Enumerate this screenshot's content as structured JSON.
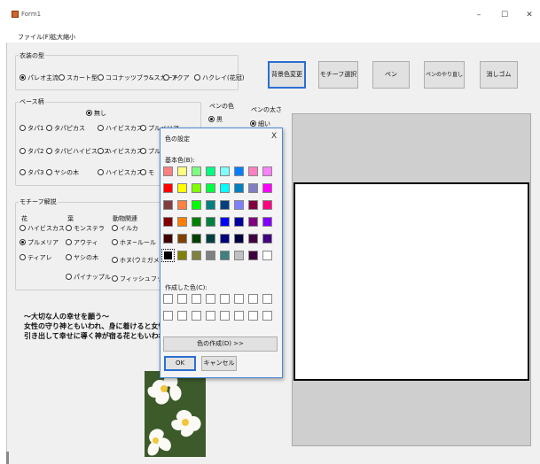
{
  "window": {
    "title": "Form1",
    "minimize_glyph": "–",
    "maximize_glyph": "☐",
    "close_glyph": "✕"
  },
  "menu": [
    "ファイル(F)",
    "拡大縮小"
  ],
  "dress_type": {
    "label": "衣装の型",
    "options": [
      "パレオ主流",
      "スカート型",
      "ココナッツブラ&スカート",
      "アクア",
      "ハクレイ(花冠)"
    ],
    "selected": 0
  },
  "base": {
    "label": "ベース柄",
    "none": "無し",
    "rows": [
      [
        "タパ1",
        "タパピカス",
        "ハイビスカス1",
        "プルメリア"
      ],
      [
        "タパ2",
        "タパビハイビスカス",
        "ハイビスカス2",
        "プル"
      ],
      [
        "タパ3",
        "ヤシの木",
        "ハイビスカス3",
        "モ"
      ]
    ]
  },
  "pen_color": {
    "label": "ペンの色",
    "option": "黒"
  },
  "pen_size": {
    "label": "ペンの太さ",
    "option": "細い"
  },
  "motif": {
    "label": "モチーフ解説",
    "headers": [
      "花",
      "葉",
      "動物関連"
    ],
    "col1": [
      "ハイビスカス",
      "プルメリア",
      "ティアレ"
    ],
    "col2": [
      "モンステラ",
      "アウティ",
      "ヤシの木",
      "パイナップル"
    ],
    "col3": [
      "イルカ",
      "ホヌ~ルール",
      "ホヌ(ウミガメ)",
      "フィッシュフック"
    ]
  },
  "description": {
    "line1": "～大切な人の幸せを願う～",
    "line2": "女性の守り神ともいわれ、身に着けると女性",
    "line3": "引き出して幸せに導く神が宿る花ともいわれ"
  },
  "toolbar": {
    "bg_color": "背景色変更",
    "motif_select": "モチーフ選択",
    "pen": "ペン",
    "pen_undo": "ペンのやり直し",
    "eraser": "消しゴム"
  },
  "color_dialog": {
    "title": "色の設定",
    "close": "X",
    "basic_label": "基本色(B):",
    "custom_label": "作成した色(C):",
    "define_button": "色の作成(D) >>",
    "ok": "OK",
    "cancel": "キャンセル",
    "basic_colors": [
      [
        "#ff8080",
        "#ffff80",
        "#80ff80",
        "#00ff80",
        "#80ffff",
        "#0080ff",
        "#ff80c0",
        "#ff80ff"
      ],
      [
        "#ff0000",
        "#ffff00",
        "#80ff00",
        "#00ff40",
        "#00ffff",
        "#0080c0",
        "#8080c0",
        "#ff00ff"
      ],
      [
        "#804040",
        "#ff8040",
        "#00ff00",
        "#008080",
        "#004080",
        "#8080ff",
        "#800040",
        "#ff0080"
      ],
      [
        "#800000",
        "#ff8000",
        "#008000",
        "#008040",
        "#0000ff",
        "#0000a0",
        "#800080",
        "#8000ff"
      ],
      [
        "#400000",
        "#804000",
        "#004000",
        "#004040",
        "#000080",
        "#000040",
        "#400040",
        "#400080"
      ],
      [
        "#000000",
        "#808000",
        "#808040",
        "#808080",
        "#408080",
        "#c0c0c0",
        "#400040",
        "#ffffff"
      ]
    ],
    "selected_index": [
      5,
      0
    ]
  }
}
